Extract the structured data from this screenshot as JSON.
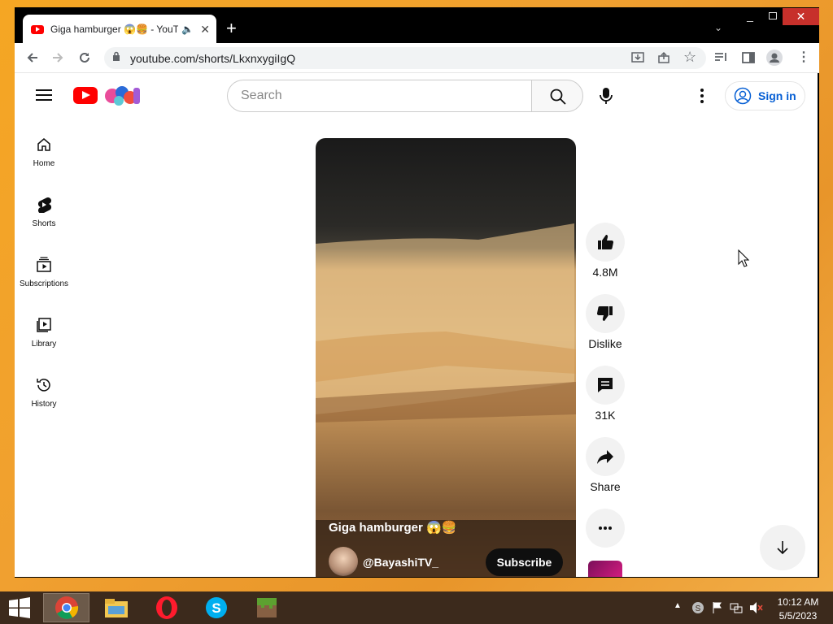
{
  "browser": {
    "tab_title": "Giga hamburger 😱🍔 - YouTube",
    "audio_icon": "speaker-icon",
    "url": "youtube.com/shorts/LkxnxygiIgQ"
  },
  "youtube": {
    "search_placeholder": "Search",
    "sign_in_label": "Sign in",
    "guide": [
      {
        "label": "Home",
        "icon": "home-icon"
      },
      {
        "label": "Shorts",
        "icon": "shorts-icon"
      },
      {
        "label": "Subscriptions",
        "icon": "subscriptions-icon"
      },
      {
        "label": "Library",
        "icon": "library-icon"
      },
      {
        "label": "History",
        "icon": "history-icon"
      }
    ],
    "short": {
      "title": "Giga hamburger 😱🍔",
      "channel": "@BayashiTV_",
      "subscribe_label": "Subscribe"
    },
    "actions": {
      "likes": "4.8M",
      "dislike_label": "Dislike",
      "comments": "31K",
      "share_label": "Share"
    }
  },
  "taskbar": {
    "apps": [
      "chrome-icon",
      "file-explorer-icon",
      "opera-icon",
      "skype-icon",
      "minecraft-icon"
    ],
    "time": "10:12 AM",
    "date": "5/5/2023"
  },
  "colors": {
    "youtube_red": "#ff0000",
    "link_blue": "#065fd4",
    "desktop_orange": "#f5a623",
    "close_red": "#c7302b"
  }
}
